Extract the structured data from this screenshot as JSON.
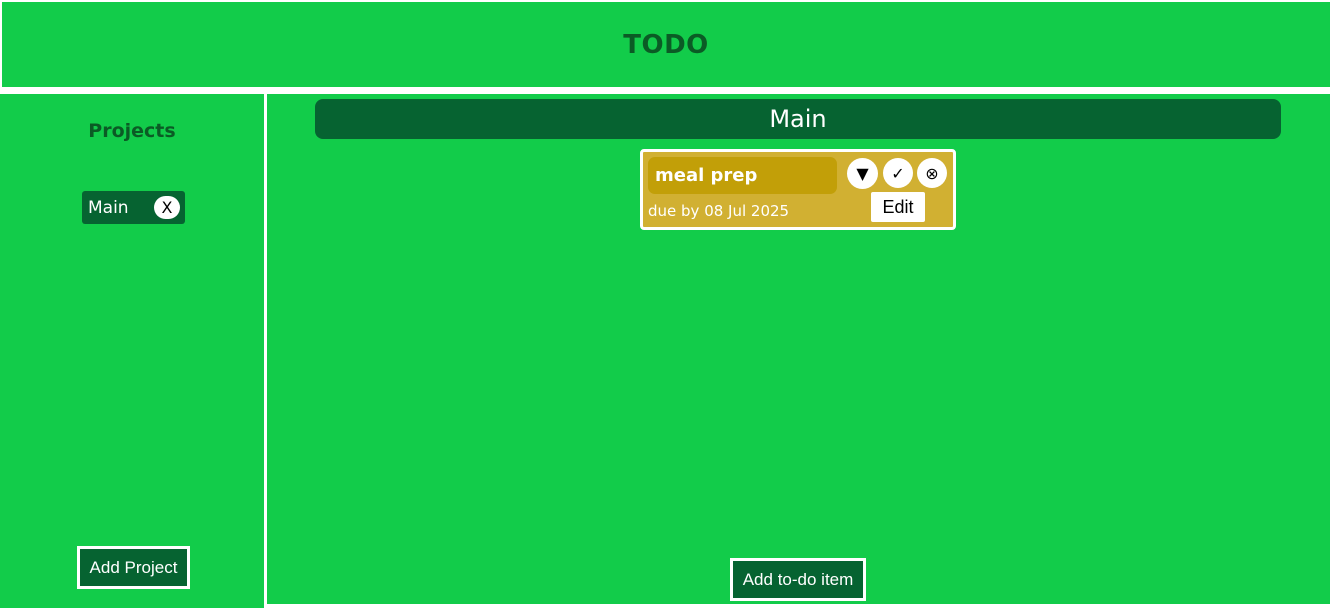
{
  "app": {
    "title": "TODO"
  },
  "sidebar": {
    "heading": "Projects",
    "projects": [
      {
        "label": "Main",
        "delete_label": "X"
      }
    ],
    "add_project_label": "Add Project"
  },
  "main": {
    "project_title": "Main",
    "todos": [
      {
        "title": "meal prep",
        "due": "due by 08 Jul 2025",
        "expand_icon": "▼",
        "complete_icon": "✓",
        "delete_icon": "⊗",
        "edit_label": "Edit"
      }
    ],
    "add_todo_label": "Add to-do item"
  },
  "colors": {
    "background": "#12cc4a",
    "dark_green": "#066331",
    "heading_green": "#0b5b25",
    "card_gold": "#d1b032",
    "card_title_gold": "#c29f08"
  }
}
